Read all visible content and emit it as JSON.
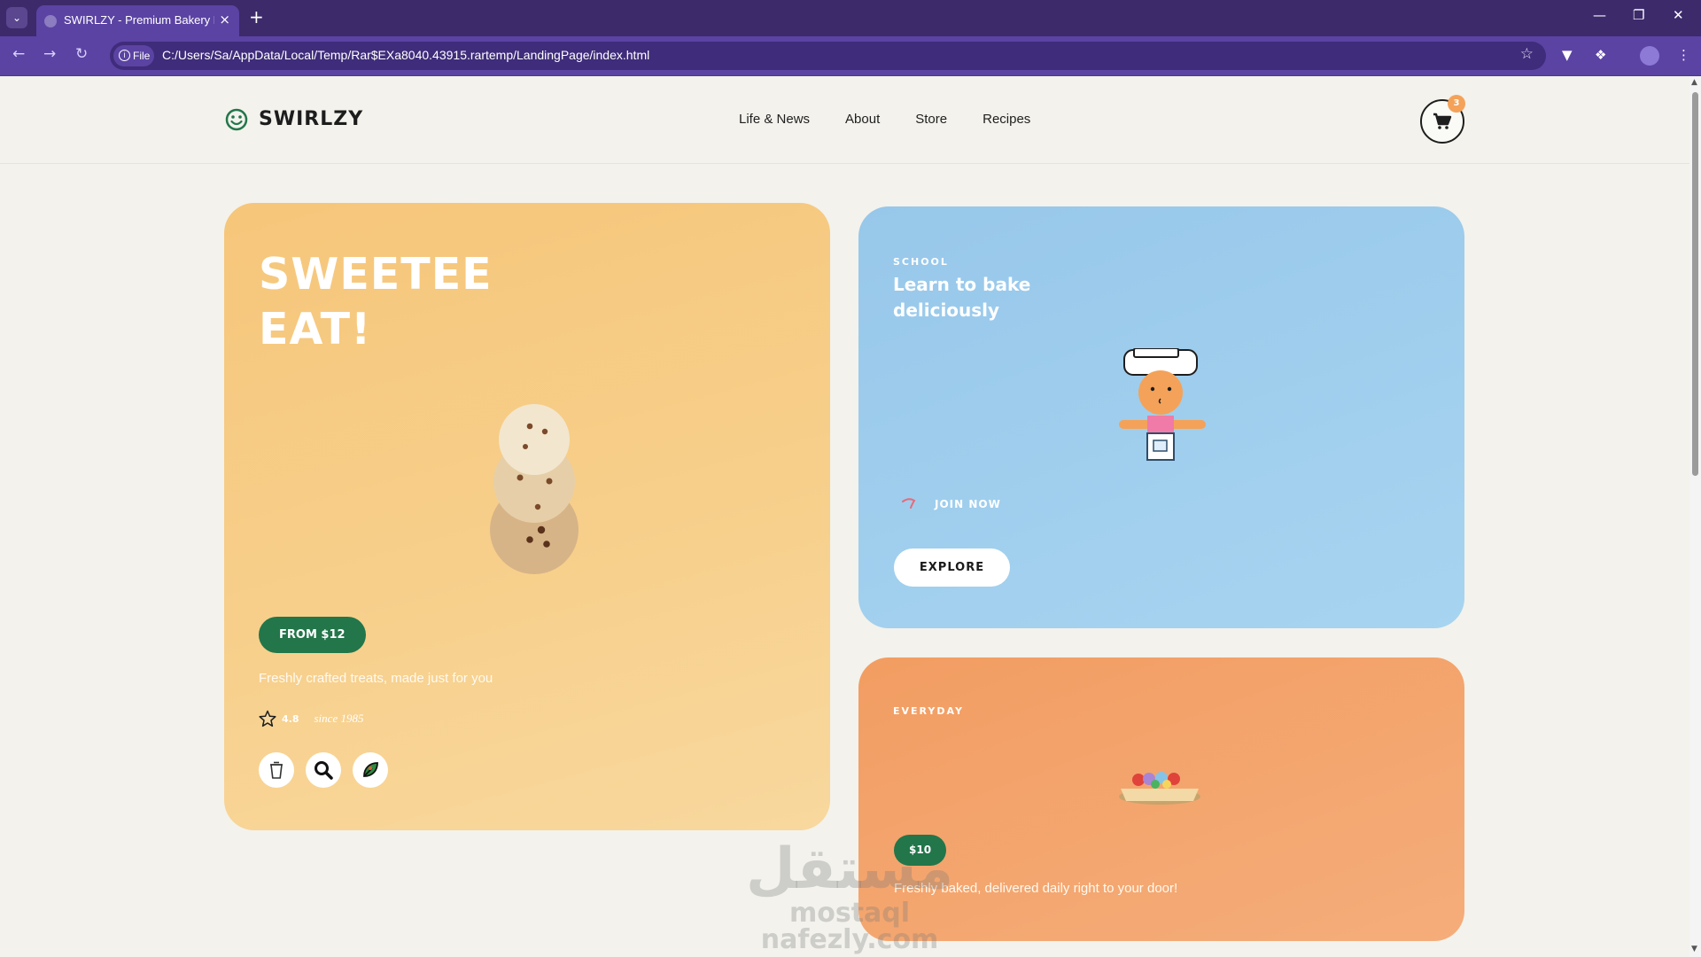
{
  "browser": {
    "tab_title": "SWIRLZY - Premium Bakery Landing Page",
    "address_chip": "File",
    "url": "C:/Users/Sa/AppData/Local/Temp/Rar$EXa8040.43915.rartemp/LandingPage/index.html"
  },
  "header": {
    "logo": "SWIRLZY",
    "nav": [
      "Life & News",
      "About",
      "Store",
      "Recipes"
    ],
    "cart_count": "3"
  },
  "hero": {
    "title_line1": "SWEETEE",
    "title_line2": "EAT!",
    "price_label": "FROM $12",
    "subtitle": "Freshly crafted treats, made just for you",
    "rating": "4.8",
    "since": "since 1985",
    "icons": [
      "cup-icon",
      "search-icon",
      "leaf-icon"
    ]
  },
  "school": {
    "eyebrow": "SCHOOL",
    "title": "Learn to bake deliciously",
    "join": "JOIN NOW",
    "explore": "EXPLORE"
  },
  "everyday": {
    "eyebrow": "EVERYDAY",
    "price": "$10",
    "subtitle": "Freshly baked, delivered daily right to your door!"
  },
  "watermark": {
    "mark": "مستقل",
    "line1": "mostaql",
    "line2": "nafezly.com"
  },
  "colors": {
    "hero_card": "#f6c67a",
    "school_card": "#97c7ea",
    "everyday_card": "#f29d62",
    "accent_green": "#22764a",
    "badge_orange": "#f4a259",
    "browser_purple": "#5b43a3"
  }
}
